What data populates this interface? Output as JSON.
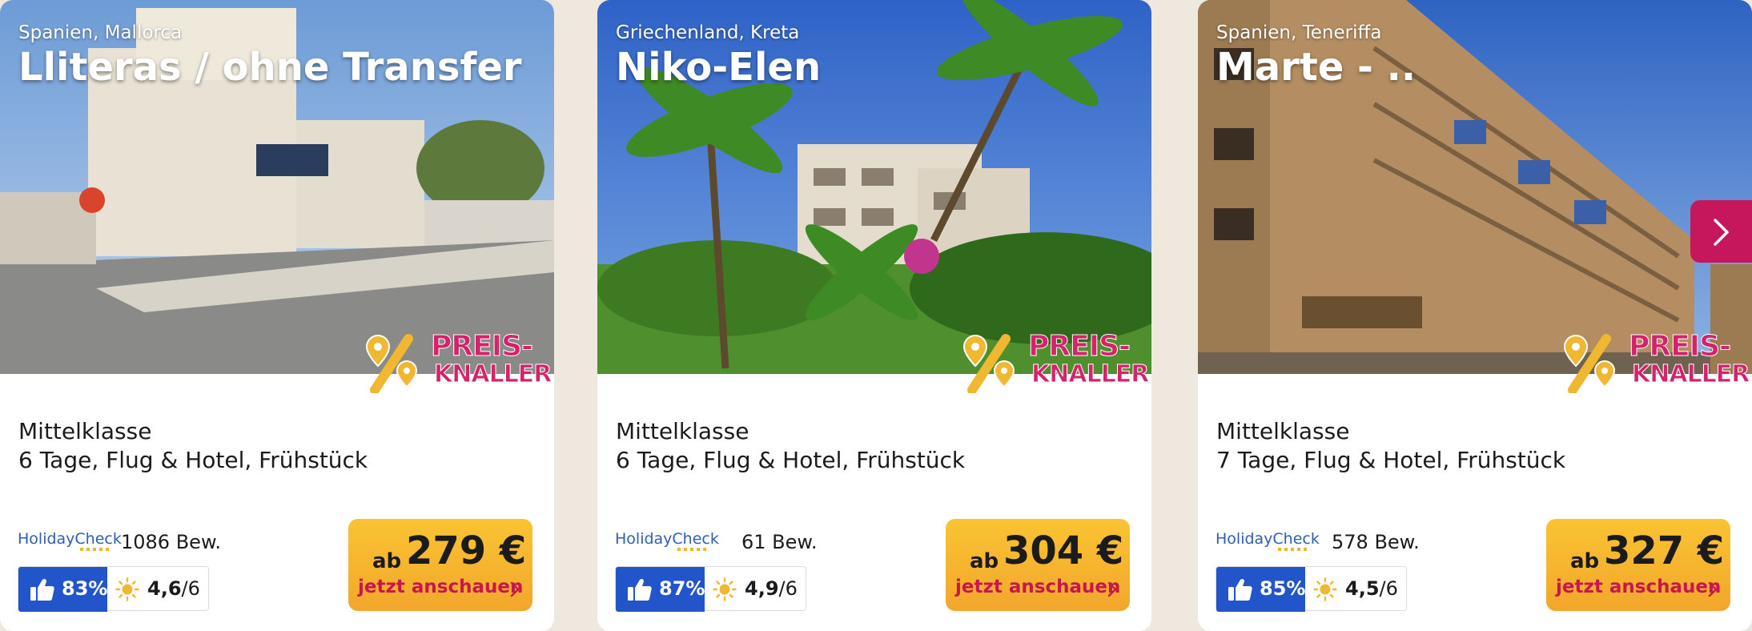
{
  "brand_colors": {
    "accent": "#c6175d",
    "price_button": "#f7b52f",
    "recommendation": "#2155c9",
    "holidaycheck_blue": "#2d5fb8"
  },
  "cards": [
    {
      "location": "Spanien, Mallorca",
      "hotel_name": "Lliteras / ohne Transfer",
      "badge": {
        "line1": "PREIS-",
        "line2": "KNALLER!"
      },
      "category": "Mittelklasse",
      "details": "6 Tage, Flug & Hotel, Frühstück",
      "holidaycheck": {
        "logo": "HolidayCheck",
        "reviews": "1086 Bew.",
        "recommendation": "83%",
        "score": "4,6",
        "score_max": "/6"
      },
      "price": {
        "prefix": "ab",
        "value": "279 €",
        "cta": "jetzt anschauen"
      }
    },
    {
      "location": "Griechenland, Kreta",
      "hotel_name": "Niko-Elen",
      "badge": {
        "line1": "PREIS-",
        "line2": "KNALLER!"
      },
      "category": "Mittelklasse",
      "details": "6 Tage, Flug & Hotel, Frühstück",
      "holidaycheck": {
        "logo": "HolidayCheck",
        "reviews": "61 Bew.",
        "recommendation": "87%",
        "score": "4,9",
        "score_max": "/6"
      },
      "price": {
        "prefix": "ab",
        "value": "304 €",
        "cta": "jetzt anschauen"
      }
    },
    {
      "location": "Spanien, Teneriffa",
      "hotel_name": "Marte - ..",
      "badge": {
        "line1": "PREIS-",
        "line2": "KNALLER!"
      },
      "category": "Mittelklasse",
      "details": "7 Tage, Flug & Hotel, Frühstück",
      "holidaycheck": {
        "logo": "HolidayCheck",
        "reviews": "578 Bew.",
        "recommendation": "85%",
        "score": "4,5",
        "score_max": "/6"
      },
      "price": {
        "prefix": "ab",
        "value": "327 €",
        "cta": "jetzt anschauen"
      }
    }
  ],
  "carousel": {
    "next_icon": "chevron-right-icon"
  }
}
